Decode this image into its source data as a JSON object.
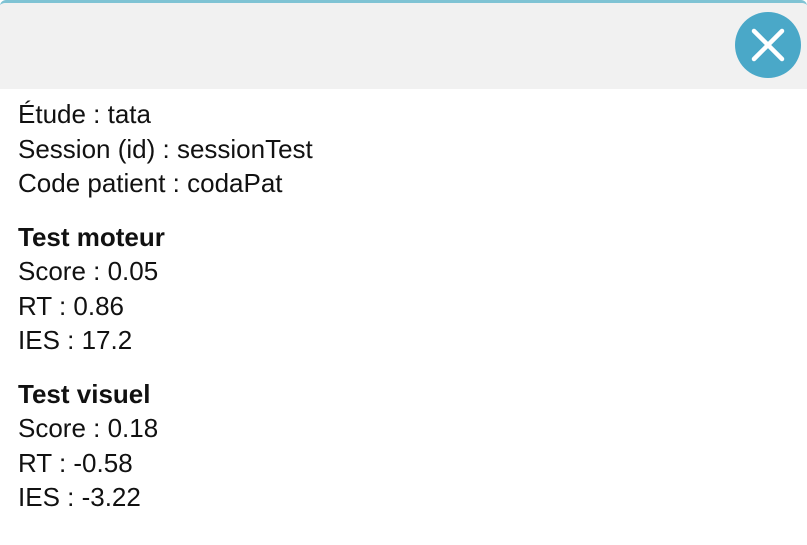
{
  "header": {
    "close_icon": "close-x-icon",
    "accent_color": "#4aa8c8"
  },
  "info": {
    "etude": "Étude : tata",
    "session": "Session (id) : sessionTest",
    "patient": "Code patient : codaPat"
  },
  "sections": [
    {
      "title": "Test moteur",
      "score": "Score : 0.05",
      "rt": "RT : 0.86",
      "ies": "IES : 17.2"
    },
    {
      "title": "Test visuel",
      "score": "Score : 0.18",
      "rt": "RT : -0.58",
      "ies": "IES : -3.22"
    }
  ]
}
